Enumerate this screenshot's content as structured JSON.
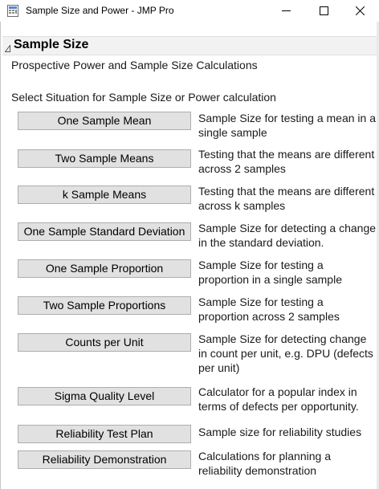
{
  "window": {
    "title": "Sample Size and Power - JMP Pro"
  },
  "section": {
    "title": "Sample Size",
    "subtitle": "Prospective Power and Sample Size Calculations",
    "instructions": "Select Situation for Sample Size or Power calculation"
  },
  "rows": [
    {
      "button": "One Sample Mean",
      "description": "Sample Size for testing a mean in a single sample"
    },
    {
      "button": "Two Sample Means",
      "description": "Testing that the means are different across 2 samples"
    },
    {
      "button": "k Sample Means",
      "description": "Testing that the means are different across k samples"
    },
    {
      "button": "One Sample Standard Deviation",
      "description": "Sample Size for detecting a change in the standard deviation."
    },
    {
      "button": "One Sample Proportion",
      "description": "Sample Size for testing a proportion in a single sample"
    },
    {
      "button": "Two Sample Proportions",
      "description": "Sample Size for testing a proportion across 2 samples"
    },
    {
      "button": "Counts per Unit",
      "description": "Sample Size for detecting change in count per unit, e.g. DPU (defects per unit)"
    },
    {
      "button": "Sigma Quality Level",
      "description": "Calculator for a popular index in terms of defects per opportunity."
    },
    {
      "button": "Reliability Test Plan",
      "description": "Sample size for reliability studies"
    },
    {
      "button": "Reliability Demonstration",
      "description": "Calculations for planning a reliability demonstration"
    }
  ]
}
